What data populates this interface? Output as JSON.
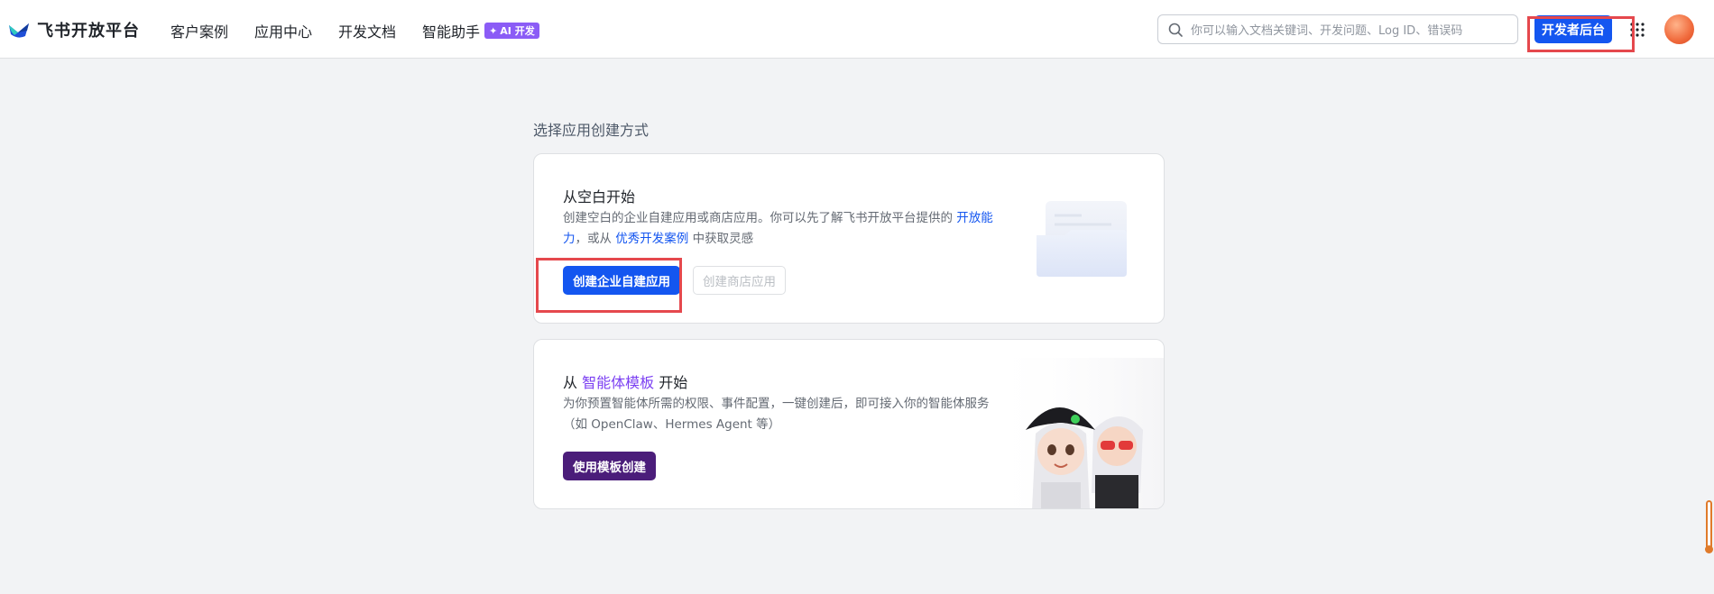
{
  "header": {
    "brand": "飞书开放平台",
    "nav": [
      {
        "label": "客户案例"
      },
      {
        "label": "应用中心"
      },
      {
        "label": "开发文档"
      },
      {
        "label": "智能助手"
      }
    ],
    "ai_badge": "AI 开发",
    "search_placeholder": "你可以输入文档关键词、开发问题、Log ID、错误码",
    "dev_console_button": "开发者后台"
  },
  "main": {
    "section_title": "选择应用创建方式",
    "blank_card": {
      "title": "从空白开始",
      "desc_part1": "创建空白的企业自建应用或商店应用。你可以先了解飞书开放平台提供的 ",
      "link1": "开放能力",
      "desc_part2": "，或从 ",
      "link2": "优秀开发案例",
      "desc_part3": " 中获取灵感",
      "primary_button": "创建企业自建应用",
      "secondary_button": "创建商店应用"
    },
    "template_card": {
      "title_prefix": "从 ",
      "title_highlight": "智能体模板",
      "title_suffix": " 开始",
      "desc": "为你预置智能体所需的权限、事件配置，一键创建后，即可接入你的智能体服务（如 OpenClaw、Hermes Agent 等）",
      "button": "使用模板创建"
    }
  },
  "colors": {
    "primary": "#1456f0",
    "purple": "#4b1d7a",
    "highlight": "#e5484d"
  }
}
